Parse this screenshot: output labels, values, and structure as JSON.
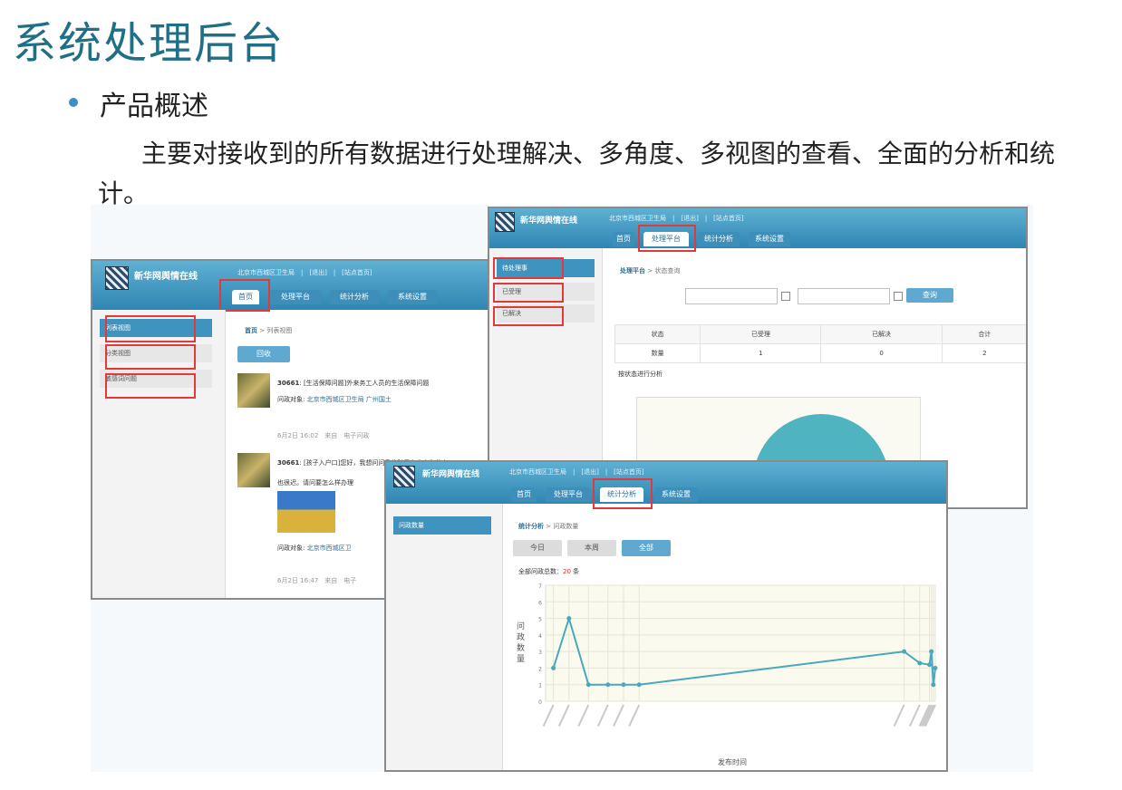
{
  "slide": {
    "title": "系统处理后台",
    "bullet": "产品概述",
    "description": "主要对接收到的所有数据进行处理解决、多角度、多视图的查看、全面的分析和统计。"
  },
  "brand": "新华网舆情在线",
  "nav_tabs": [
    "首页",
    "处理平台",
    "统计分析",
    "系统设置"
  ],
  "window1": {
    "top_info": "北京市西城区卫生局　|　[退出]　|　[站点首页]",
    "sidebar": [
      "列表视图",
      "分类视图",
      "敏感词问题"
    ],
    "breadcrumb_home": "首页",
    "breadcrumb_sep": ">",
    "breadcrumb_current": "列表视图",
    "ask_button": "回收",
    "items": [
      {
        "id": "30661",
        "title": "[生活保障问题]外来务工人员的生活保障问题",
        "target_label": "问政对象:",
        "target": "北京市西城区卫生局 广州国土",
        "meta": "6月2日 16:02　来自　电子问政"
      },
      {
        "id": "30661",
        "title": "[孩子入户口]您好，我想问问我的孩子在北京为什么",
        "line2": "也很迟。请问要怎么样办理",
        "target_label": "问政对象:",
        "target": "北京市西城区卫",
        "meta": "6月2日 16:47　来自　电子"
      }
    ]
  },
  "window2": {
    "top_info": "北京市西城区卫生局　|　[退出]　|　[站点首页]",
    "sidebar": [
      "待处理事",
      "已受理",
      "已解决"
    ],
    "breadcrumb_home": "处理平台",
    "breadcrumb_sep": ">",
    "breadcrumb_current": "状态查询",
    "query_button": "查询",
    "table": {
      "headers": [
        "状态",
        "已受理",
        "已解决",
        "合计"
      ],
      "row": [
        "数量",
        "1",
        "0",
        "2"
      ]
    },
    "chart_label": "按状态进行分析"
  },
  "window3": {
    "top_info": "北京市西城区卫生局　|　[退出]　|　[站点首页]",
    "sidebar": [
      "问政数量"
    ],
    "breadcrumb_home": "统计分析",
    "breadcrumb_sep": ">",
    "breadcrumb_current": "问政数量",
    "range_buttons": [
      "今日",
      "本周",
      "全部"
    ],
    "total_label": "全部问政总数：",
    "total_value": "20",
    "total_unit": "条",
    "y_label": "问政数量",
    "x_label": "发布时间"
  },
  "chart_data": {
    "type": "line",
    "x": [
      1,
      2,
      3,
      4,
      5,
      6,
      7,
      8,
      9,
      10,
      11,
      12
    ],
    "y": [
      2,
      5,
      1,
      1,
      1,
      1,
      3,
      2.3,
      2.2,
      3,
      1,
      2
    ],
    "ylim": [
      0,
      7
    ],
    "xlabel": "发布时间",
    "ylabel": "问政数量",
    "grid": true
  },
  "colors": {
    "title": "#1f6f87",
    "accent": "#3f93bf",
    "highlight": "#e23a3a",
    "line": "#4aa8bb"
  }
}
